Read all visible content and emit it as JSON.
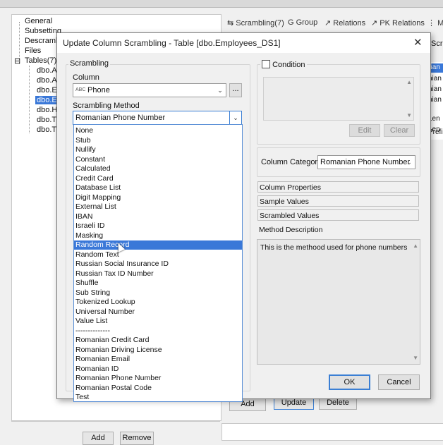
{
  "background": {
    "tree": {
      "items": [
        "General",
        "Subsetting",
        "Descramble",
        "Files",
        "Tables(7)",
        "dbo.As",
        "dbo.As",
        "dbo.Em",
        "dbo.Em",
        "dbo.Ho",
        "dbo.Tic",
        "dbo.Tic"
      ],
      "collapse_glyph": "⊟"
    },
    "tabs": [
      "Scrambling(7)",
      "Group",
      "Relations",
      "PK Relations",
      "Ma"
    ],
    "right_cells": [
      "nian",
      "nian",
      "nian",
      "nian",
      ", Len",
      ", Len",
      "Prefi"
    ],
    "buttons": {
      "add": "Add",
      "update": "Update",
      "delete": "Delete",
      "add2": "Add",
      "remove": "Remove"
    },
    "sidebar_tab": "Scra"
  },
  "dialog": {
    "title": "Update Column Scrambling - Table [dbo.Employees_DS1]",
    "close": "✕",
    "scrambling": {
      "group_title": "Scrambling",
      "column_label": "Column",
      "column_type_prefix": "ABC",
      "column_value": "Phone",
      "browse_button": "...",
      "method_label": "Scrambling Method",
      "method_value": "Romanian Phone Number",
      "options": [
        "None",
        "Stub",
        "Nullify",
        "Constant",
        "Calculated",
        "Credit Card",
        "Database List",
        "Digit Mapping",
        "External List",
        "IBAN",
        "Israeli ID",
        "Masking",
        "Random Record",
        "Random Text",
        "Russian Social Insurance ID",
        "Russian Tax ID Number",
        "Shuffle",
        "Sub String",
        "Tokenized Lookup",
        "Universal Number",
        "Value List",
        "--------------",
        "Romanian Credit Card",
        "Romanian Driving License",
        "Romanian Email",
        "Romanian ID",
        "Romanian Phone Number",
        "Romanian Postal Code",
        "Test"
      ],
      "highlighted_index": 12
    },
    "condition": {
      "label": "Condition",
      "edit": "Edit",
      "clear": "Clear"
    },
    "column_category": {
      "label": "Column Category",
      "value": "Romanian Phone Number"
    },
    "sections": [
      "Column Properties",
      "Sample Values",
      "Scrambled Values",
      "Method Description"
    ],
    "description": "This is the methood used for phone numbers",
    "ok": "OK",
    "cancel": "Cancel"
  },
  "colors": {
    "selection": "#3a78d8",
    "focus_border": "#3b7fd4"
  }
}
